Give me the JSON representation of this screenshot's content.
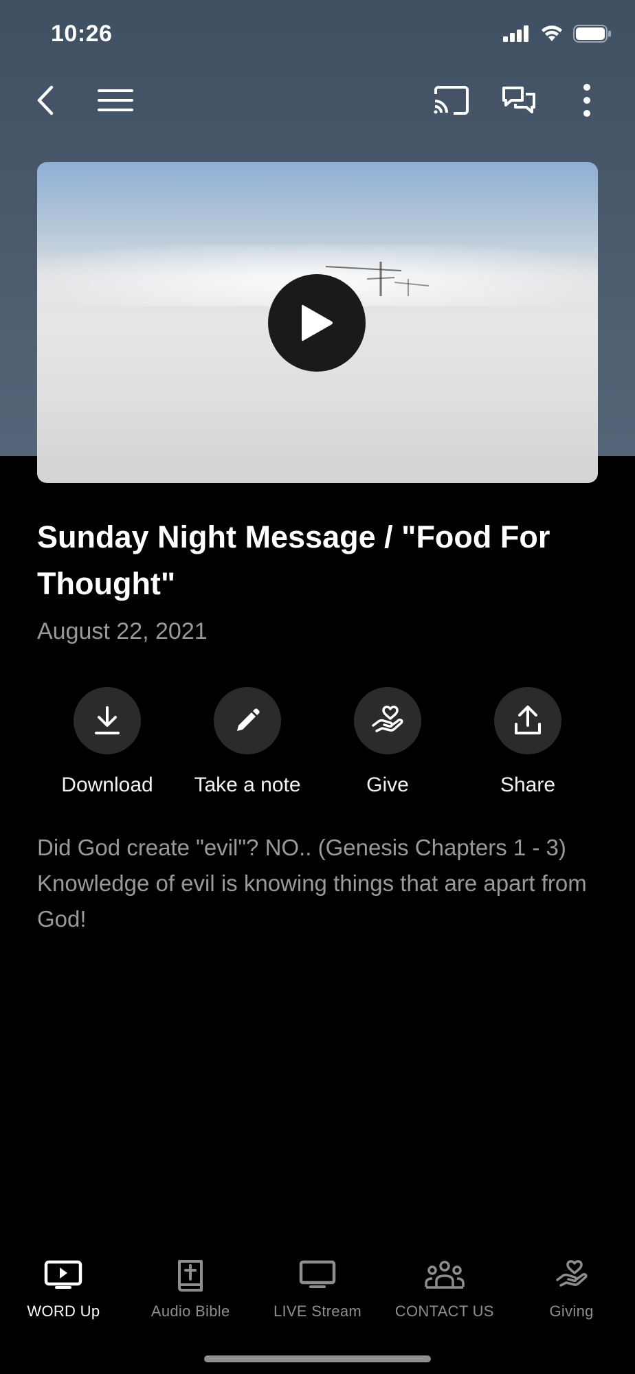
{
  "status_bar": {
    "time": "10:26"
  },
  "video": {
    "title": "Sunday Night Message / \"Food For Thought\"",
    "date": "August 22, 2021"
  },
  "actions": [
    {
      "label": "Download",
      "icon": "download-icon"
    },
    {
      "label": "Take a note",
      "icon": "pencil-icon"
    },
    {
      "label": "Give",
      "icon": "giving-hand-icon"
    },
    {
      "label": "Share",
      "icon": "share-icon"
    }
  ],
  "description": {
    "line1": "Did God create \"evil\"? NO.. (Genesis Chapters 1 - 3)",
    "line2": "Knowledge of evil is knowing things that are apart from God!"
  },
  "tabs": [
    {
      "label": "WORD Up",
      "icon": "tv-play-icon",
      "active": true
    },
    {
      "label": "Audio Bible",
      "icon": "bible-icon",
      "active": false
    },
    {
      "label": "LIVE Stream",
      "icon": "monitor-icon",
      "active": false
    },
    {
      "label": "CONTACT US",
      "icon": "people-icon",
      "active": false
    },
    {
      "label": "Giving",
      "icon": "giving-hand-icon",
      "active": false
    }
  ],
  "colors": {
    "header_bg": "#4a5a6c",
    "background": "#000000",
    "muted_text": "#9a9a9a",
    "action_circle": "#2b2b2b"
  }
}
